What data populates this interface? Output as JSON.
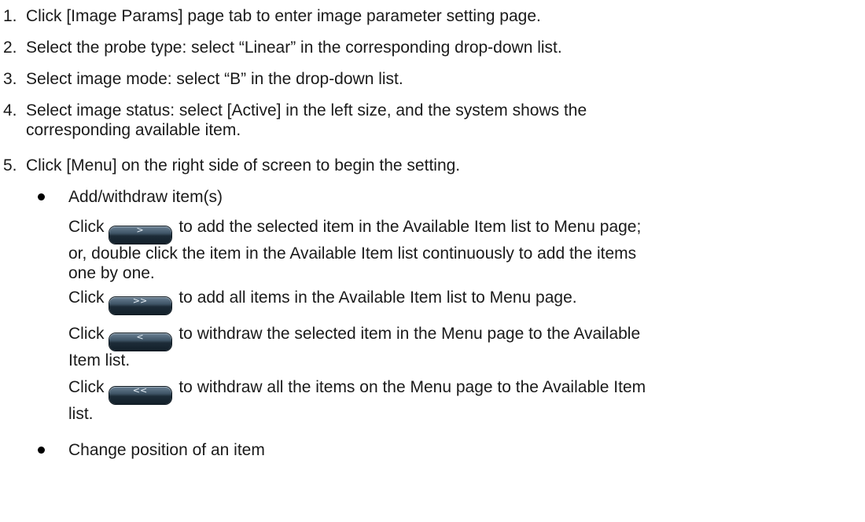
{
  "steps": [
    {
      "num": "1.",
      "text": "Click [Image Params] page tab to enter image parameter setting page."
    },
    {
      "num": "2.",
      "text": "Select the probe type: select “Linear” in the corresponding drop-down list."
    },
    {
      "num": "3.",
      "text": "Select image mode: select “B” in the drop-down list."
    },
    {
      "num": "4.",
      "text_line1": "Select image status: select [Active] in the left size, and the system shows the",
      "text_line2": "corresponding available item."
    },
    {
      "num": "5.",
      "text": "Click [Menu] on the right side of screen to begin the setting."
    }
  ],
  "bullets": [
    {
      "text": "Add/withdraw item(s)"
    },
    {
      "text": "Change position of an item"
    }
  ],
  "paragraphs": [
    {
      "lead": "Click",
      "button_label": ">",
      "line1": "to add the selected item in the Available Item list to Menu page;",
      "line2": "or, double click the item in the Available Item list continuously to add the items",
      "line3": "one by one."
    },
    {
      "lead": "Click",
      "button_label": ">>",
      "line1": "to add all items in the Available Item list to Menu page."
    },
    {
      "lead": "Click",
      "button_label": "<",
      "line1": "to withdraw the selected item in the Menu page to the Available",
      "line2": "Item list."
    },
    {
      "lead": "Click",
      "button_label": "<<",
      "line1": "to withdraw all the items on the Menu page to the Available Item",
      "line2": "list."
    }
  ]
}
